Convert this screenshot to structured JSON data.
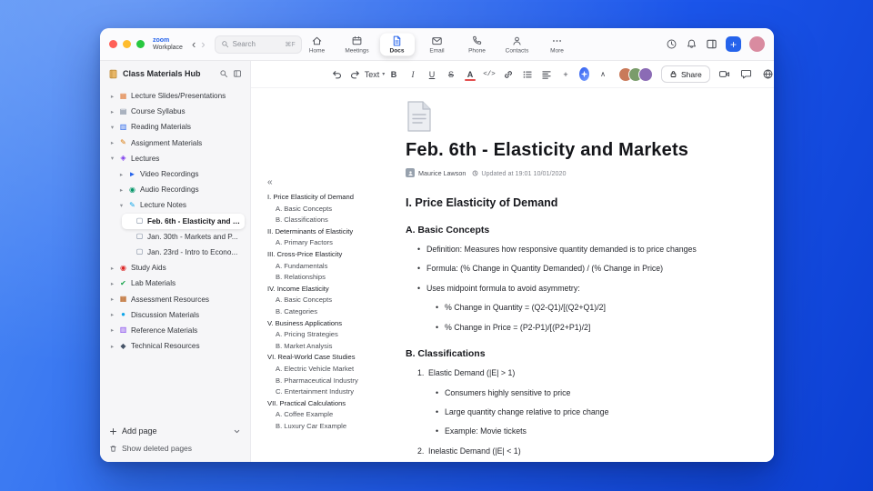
{
  "chrome": {
    "brand": {
      "line1": "zoom",
      "line2": "Workplace"
    },
    "nav": {
      "back": "‹",
      "forward": "›"
    },
    "search": {
      "placeholder": "Search",
      "shortcut": "⌘F"
    },
    "tabs": [
      {
        "label": "Home",
        "icon": "home",
        "active": false
      },
      {
        "label": "Meetings",
        "icon": "meetings",
        "active": false
      },
      {
        "label": "Docs",
        "icon": "docs",
        "active": true
      },
      {
        "label": "Email",
        "icon": "email",
        "active": false
      },
      {
        "label": "Phone",
        "icon": "phone",
        "active": false
      },
      {
        "label": "Contacts",
        "icon": "contacts",
        "active": false
      },
      {
        "label": "More",
        "icon": "more",
        "active": false
      }
    ],
    "user_avatar_color": "#d98ba0"
  },
  "sidebar": {
    "title": "Class Materials Hub",
    "items": [
      {
        "label": "Lecture Slides/Presentations",
        "level": 0,
        "expanded": false,
        "glyph": "▦",
        "color": "#e07b39"
      },
      {
        "label": "Course Syllabus",
        "level": 0,
        "expanded": false,
        "glyph": "▤",
        "color": "#64748b"
      },
      {
        "label": "Reading Materials",
        "level": 0,
        "expanded": true,
        "glyph": "▥",
        "color": "#2563eb"
      },
      {
        "label": "Assignment Materials",
        "level": 0,
        "expanded": false,
        "glyph": "✎",
        "color": "#d97706"
      },
      {
        "label": "Lectures",
        "level": 0,
        "expanded": true,
        "glyph": "◈",
        "color": "#7c3aed"
      },
      {
        "label": "Video Recordings",
        "level": 1,
        "expanded": false,
        "glyph": "►",
        "color": "#2563eb"
      },
      {
        "label": "Audio Recordings",
        "level": 1,
        "expanded": false,
        "glyph": "◉",
        "color": "#059669"
      },
      {
        "label": "Lecture Notes",
        "level": 1,
        "expanded": true,
        "glyph": "✎",
        "color": "#0ea5e9"
      },
      {
        "label": "Feb. 6th - Elasticity and M...",
        "level": 2,
        "selected": true,
        "glyph": "▢",
        "color": "#64748b"
      },
      {
        "label": "Jan. 30th - Markets and P...",
        "level": 2,
        "glyph": "▢",
        "color": "#64748b"
      },
      {
        "label": "Jan. 23rd - Intro to Econo...",
        "level": 2,
        "glyph": "▢",
        "color": "#64748b"
      },
      {
        "label": "Study Aids",
        "level": 0,
        "expanded": false,
        "glyph": "◉",
        "color": "#dc2626"
      },
      {
        "label": "Lab Materials",
        "level": 0,
        "expanded": false,
        "glyph": "✔",
        "color": "#16a34a"
      },
      {
        "label": "Assessment Resources",
        "level": 0,
        "expanded": false,
        "glyph": "▦",
        "color": "#b45309"
      },
      {
        "label": "Discussion Materials",
        "level": 0,
        "expanded": false,
        "glyph": "●",
        "color": "#0ea5e9"
      },
      {
        "label": "Reference Materials",
        "level": 0,
        "expanded": false,
        "glyph": "▥",
        "color": "#7c3aed"
      },
      {
        "label": "Technical Resources",
        "level": 0,
        "expanded": false,
        "glyph": "◆",
        "color": "#475569"
      }
    ],
    "add_page": "Add page",
    "show_deleted": "Show deleted pages"
  },
  "toolbar": {
    "text_style": "Text",
    "caret": "▾",
    "bold": "B",
    "italic": "I",
    "underline": "U",
    "strike": "S",
    "color": "A",
    "code": "</>",
    "plus": "+",
    "collapse": "∧",
    "share": "Share",
    "collaborators": [
      {
        "color": "#c97a5a"
      },
      {
        "color": "#7a9c6b"
      },
      {
        "color": "#8b6bb5"
      }
    ]
  },
  "doc": {
    "toc_collapse": "«",
    "title": "Feb. 6th - Elasticity and Markets",
    "author": "Maurice Lawson",
    "updated": "Updated at 19:01 10/01/2020",
    "toc": [
      {
        "text": "I. Price Elasticity of Demand",
        "level": 0
      },
      {
        "text": "A. Basic Concepts",
        "level": 1
      },
      {
        "text": "B. Classifications",
        "level": 1
      },
      {
        "text": "II. Determinants of Elasticity",
        "level": 0
      },
      {
        "text": "A. Primary Factors",
        "level": 1
      },
      {
        "text": "III. Cross-Price Elasticity",
        "level": 0
      },
      {
        "text": "A. Fundamentals",
        "level": 1
      },
      {
        "text": "B. Relationships",
        "level": 1
      },
      {
        "text": "IV. Income Elasticity",
        "level": 0
      },
      {
        "text": "A. Basic Concepts",
        "level": 1
      },
      {
        "text": "B. Categories",
        "level": 1
      },
      {
        "text": "V. Business Applications",
        "level": 0
      },
      {
        "text": "A. Pricing Strategies",
        "level": 1
      },
      {
        "text": "B. Market Analysis",
        "level": 1
      },
      {
        "text": "VI. Real-World Case Studies",
        "level": 0
      },
      {
        "text": "A. Electric Vehicle Market",
        "level": 1
      },
      {
        "text": "B. Pharmaceutical Industry",
        "level": 1
      },
      {
        "text": "C. Entertainment Industry",
        "level": 1
      },
      {
        "text": "VII. Practical Calculations",
        "level": 0
      },
      {
        "text": "A. Coffee Example",
        "level": 1
      },
      {
        "text": "B. Luxury Car Example",
        "level": 1
      }
    ],
    "blocks": [
      {
        "type": "h2",
        "text": "I. Price Elasticity of Demand"
      },
      {
        "type": "h3",
        "text": "A. Basic Concepts"
      },
      {
        "type": "l1",
        "text": "Definition: Measures how responsive quantity demanded is to price changes"
      },
      {
        "type": "l1",
        "text": "Formula: (% Change in Quantity Demanded) / (% Change in Price)"
      },
      {
        "type": "l1",
        "text": "Uses midpoint formula to avoid asymmetry:"
      },
      {
        "type": "l2",
        "text": "% Change in Quantity = (Q2-Q1)/[(Q2+Q1)/2]"
      },
      {
        "type": "l2",
        "text": "% Change in Price = (P2-P1)/[(P2+P1)/2]"
      },
      {
        "type": "h3",
        "text": "B. Classifications"
      },
      {
        "type": "num",
        "num": "1.",
        "text": "Elastic Demand (|E| > 1)"
      },
      {
        "type": "l2",
        "text": "Consumers highly sensitive to price"
      },
      {
        "type": "l2",
        "text": "Large quantity change relative to price change"
      },
      {
        "type": "l2",
        "text": "Example: Movie tickets"
      },
      {
        "type": "num",
        "num": "2.",
        "text": "Inelastic Demand (|E| < 1)"
      }
    ]
  }
}
